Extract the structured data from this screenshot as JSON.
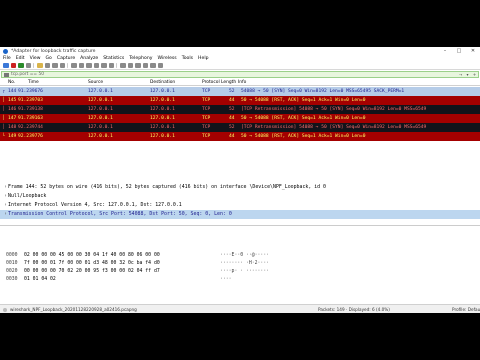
{
  "window": {
    "title": "*Adapter for loopback traffic capture",
    "controls": [
      "–",
      "□",
      "✕"
    ]
  },
  "menu": [
    "File",
    "Edit",
    "View",
    "Go",
    "Capture",
    "Analyze",
    "Statistics",
    "Telephony",
    "Wireless",
    "Tools",
    "Help"
  ],
  "filter": {
    "text": "tcp.port == 50",
    "buttons": [
      "→",
      "▾",
      "+"
    ]
  },
  "packet_columns": [
    "No.",
    "Time",
    "Source",
    "Destination",
    "Protocol",
    "Length",
    "Info"
  ],
  "packets": [
    {
      "no": "144",
      "time": "91.239676",
      "src": "127.0.0.1",
      "dst": "127.0.0.1",
      "proto": "TCP",
      "len": "52",
      "info": "54088 → 50 [SYN] Seq=0 Win=8192 Len=0 MSS=65495 SACK_PERM=1",
      "style": "sel",
      "arrow": "┌"
    },
    {
      "no": "145",
      "time": "91.239703",
      "src": "127.0.0.1",
      "dst": "127.0.0.1",
      "proto": "TCP",
      "len": "44",
      "info": "50 → 54088 [RST, ACK] Seq=1 Ack=1 Win=0 Len=0",
      "style": "rst",
      "arrow": "│"
    },
    {
      "no": "146",
      "time": "91.739138",
      "src": "127.0.0.1",
      "dst": "127.0.0.1",
      "proto": "TCP",
      "len": "52",
      "info": "[TCP Retransmission] 54088 → 50 [SYN] Seq=0 Win=8192 Len=0 MSS=6549",
      "style": "dark",
      "arrow": "│"
    },
    {
      "no": "147",
      "time": "91.739163",
      "src": "127.0.0.1",
      "dst": "127.0.0.1",
      "proto": "TCP",
      "len": "44",
      "info": "50 → 54088 [RST, ACK] Seq=1 Ack=1 Win=0 Len=0",
      "style": "rst",
      "arrow": "│"
    },
    {
      "no": "148",
      "time": "92.239744",
      "src": "127.0.0.1",
      "dst": "127.0.0.1",
      "proto": "TCP",
      "len": "52",
      "info": "[TCP Retransmission] 54088 → 50 [SYN] Seq=0 Win=8192 Len=0 MSS=6549",
      "style": "dark",
      "arrow": "│"
    },
    {
      "no": "149",
      "time": "92.239776",
      "src": "127.0.0.1",
      "dst": "127.0.0.1",
      "proto": "TCP",
      "len": "44",
      "info": "50 → 54088 [RST, ACK] Seq=1 Ack=1 Win=0 Len=0",
      "style": "rst",
      "arrow": "└"
    }
  ],
  "details": [
    {
      "text": "Frame 144: 52 bytes on wire (416 bits), 52 bytes captured (416 bits) on interface \\Device\\NPF_Loopback, id 0",
      "hl": false
    },
    {
      "text": "Null/Loopback",
      "hl": false
    },
    {
      "text": "Internet Protocol Version 4, Src: 127.0.0.1, Dst: 127.0.0.1",
      "hl": false
    },
    {
      "text": "Transmission Control Protocol, Src Port: 54088, Dst Port: 50, Seq: 0, Len: 0",
      "hl": true
    }
  ],
  "hex_rows": [
    {
      "off": "0000",
      "bytes": "02 00 00 00 45 00 00 30  04 1f 40 00 80 06 00 00",
      "ascii": "····E··0 ··@·····"
    },
    {
      "off": "0010",
      "bytes": "7f 00 00 01 7f 00 00 01  d3 48 00 32 0c ba f4 d0",
      "ascii": "········ ·H·2····"
    },
    {
      "off": "0020",
      "bytes": "00 00 00 00 70 02 20 00  95 f3 00 00 02 04 ff d7",
      "ascii": "····p· · ········"
    },
    {
      "off": "0030",
      "bytes": "01 01 04 02",
      "ascii": "····"
    }
  ],
  "status": {
    "file": "wireshark_NPF_Loopback_20201128220928_a02416.pcapng",
    "counts": "Packets: 149 · Displayed: 6 (4.0%)",
    "profile": "Profile: Default"
  }
}
